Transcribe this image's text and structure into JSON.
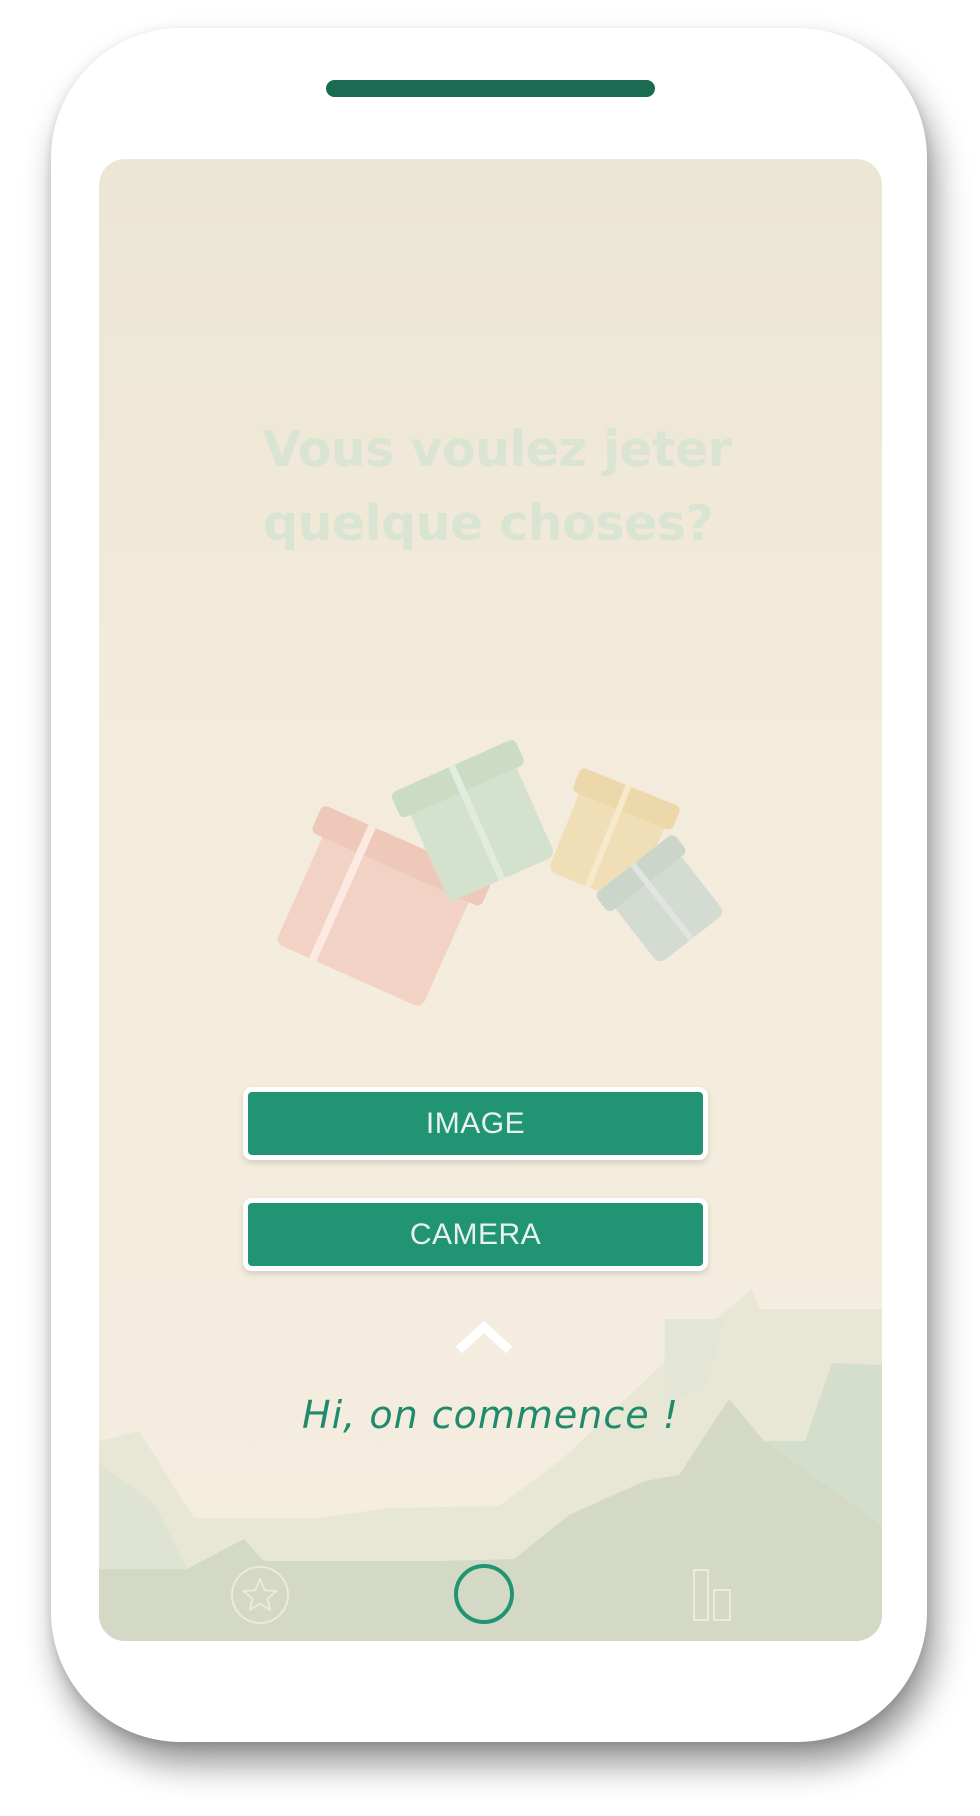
{
  "screen": {
    "headline": "Vous voulez jeter quelque choses?",
    "greeting": "Hi, on commence !"
  },
  "actions": {
    "image_label": "IMAGE",
    "camera_label": "CAMERA"
  },
  "nav": {
    "items": [
      {
        "icon": "star-icon",
        "label": "favorites"
      },
      {
        "icon": "circle-icon",
        "label": "home",
        "active": true
      },
      {
        "icon": "bar-chart-icon",
        "label": "statistics"
      }
    ]
  },
  "colors": {
    "accent": "#219474",
    "accent_dark": "#1a6b52",
    "background": "#f5eddf",
    "headline": "#d9e4d2",
    "gift_pink": "#f2d2c4",
    "gift_green": "#d3e1cd",
    "gift_yellow": "#f0dfb6",
    "gift_grey": "#d3dbd2"
  }
}
